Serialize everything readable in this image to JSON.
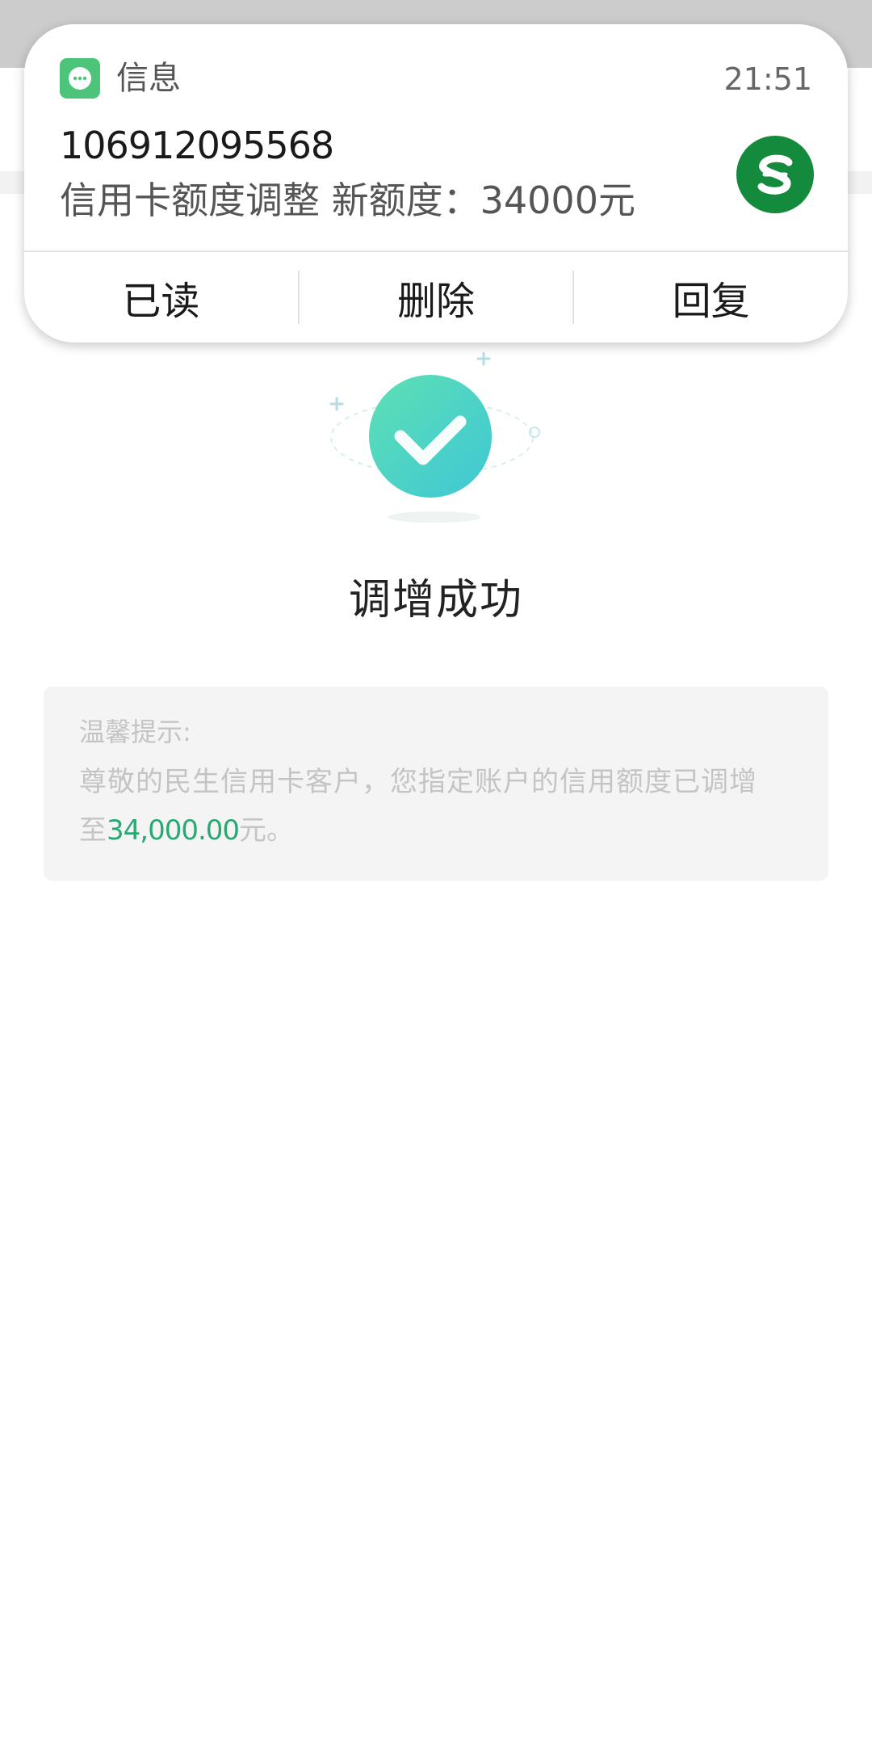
{
  "notification": {
    "app_name": "信息",
    "time": "21:51",
    "sender": "106912095568",
    "message": "信用卡额度调整 新额度：34000元",
    "app_icon": "message-bubble-icon",
    "avatar_icon": "bank-logo-icon",
    "actions": {
      "mark_read": "已读",
      "delete": "删除",
      "reply": "回复"
    }
  },
  "main": {
    "status_icon": "check-circle-icon",
    "title": "调增成功",
    "tip": {
      "title": "温馨提示:",
      "line1": "尊敬的民生信用卡客户，您指定账户的信用额度已调增",
      "line2_prefix": "至",
      "amount": "34,000.00",
      "line2_suffix": "元。"
    }
  },
  "colors": {
    "accent_green": "#2aa874",
    "app_icon_green": "#4cc47a",
    "bank_green": "#148a3d",
    "check_gradient_start": "#5ee0b3",
    "check_gradient_end": "#3ec7d6"
  }
}
